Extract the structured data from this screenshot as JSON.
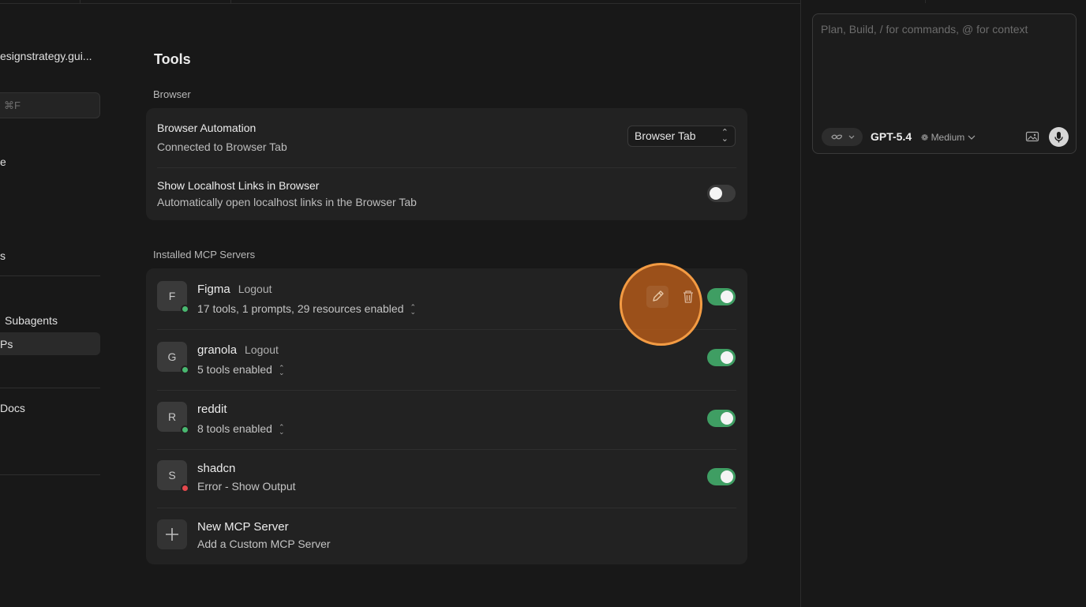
{
  "sidebar": {
    "workspace_name": "esignstrategy.gui...",
    "search_shortcut": "⌘F",
    "item_1": "e",
    "item_2": "s",
    "item_subagents": "Subagents",
    "item_active": "Ps",
    "item_docs": "Docs"
  },
  "main": {
    "title": "Tools",
    "browser_section": "Browser",
    "browser_automation": {
      "title": "Browser Automation",
      "subtitle": "Connected to Browser Tab",
      "select_value": "Browser Tab"
    },
    "localhost_links": {
      "title": "Show Localhost Links in Browser",
      "subtitle": "Automatically open localhost links in the Browser Tab",
      "enabled": false
    },
    "mcp_section": "Installed MCP Servers",
    "servers": [
      {
        "initial": "F",
        "name": "Figma",
        "logout": "Logout",
        "summary": "17 tools, 1 prompts, 29 resources enabled",
        "status": "green",
        "enabled": true
      },
      {
        "initial": "G",
        "name": "granola",
        "logout": "Logout",
        "summary": "5 tools enabled",
        "status": "green",
        "enabled": true
      },
      {
        "initial": "R",
        "name": "reddit",
        "logout": "",
        "summary": "8 tools enabled",
        "status": "green",
        "enabled": true
      },
      {
        "initial": "S",
        "name": "shadcn",
        "logout": "",
        "summary": "Error - Show Output",
        "status": "red",
        "enabled": true
      }
    ],
    "new_server": {
      "title": "New MCP Server",
      "subtitle": "Add a Custom MCP Server"
    }
  },
  "composer": {
    "placeholder": "Plan, Build, / for commands, @ for context",
    "model": "GPT-5.4",
    "effort": "Medium"
  },
  "colors": {
    "toggle_on": "#3f9e63",
    "status_ok": "#49b870",
    "status_error": "#e5484d",
    "highlight": "#f39b43"
  },
  "icons": [
    "pencil-icon",
    "trash-icon",
    "plus-icon",
    "infinity-icon",
    "chevron-down-icon",
    "image-icon",
    "microphone-icon",
    "up-down-chevron-icon",
    "brain-icon"
  ]
}
